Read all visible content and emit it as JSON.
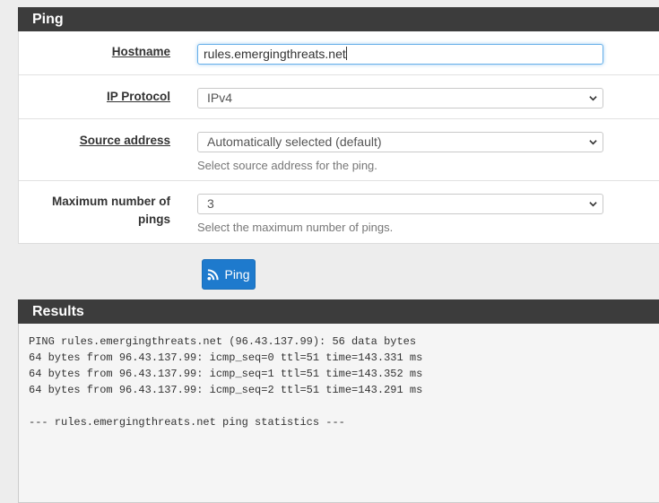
{
  "ping_panel": {
    "title": "Ping",
    "hostname": {
      "label": "Hostname",
      "value": "rules.emergingthreats.net"
    },
    "ip_protocol": {
      "label": "IP Protocol",
      "selected": "IPv4"
    },
    "source_address": {
      "label": "Source address",
      "selected": "Automatically selected (default)",
      "help": "Select source address for the ping."
    },
    "max_pings": {
      "label_line1": "Maximum number of",
      "label_line2": "pings",
      "selected": "3",
      "help": "Select the maximum number of pings."
    },
    "ping_button_label": "Ping",
    "ping_button_icon": "rss-icon"
  },
  "results_panel": {
    "title": "Results",
    "lines": [
      "PING rules.emergingthreats.net (96.43.137.99): 56 data bytes",
      "64 bytes from 96.43.137.99: icmp_seq=0 ttl=51 time=143.331 ms",
      "64 bytes from 96.43.137.99: icmp_seq=1 ttl=51 time=143.352 ms",
      "64 bytes from 96.43.137.99: icmp_seq=2 ttl=51 time=143.291 ms",
      "",
      "--- rules.emergingthreats.net ping statistics ---"
    ]
  },
  "colors": {
    "heading_bg": "#3c3c3c",
    "button_bg": "#1e7acd",
    "page_bg": "#ededed"
  }
}
